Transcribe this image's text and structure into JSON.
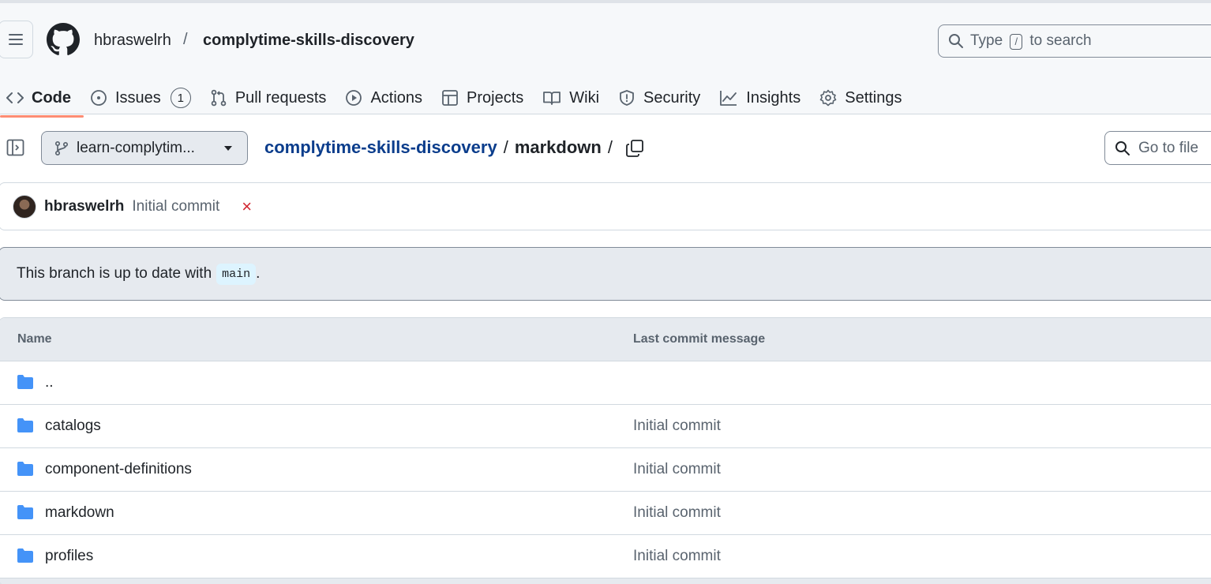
{
  "header": {
    "owner": "hbraswelrh",
    "separator": "/",
    "repo": "complytime-skills-discovery",
    "search": {
      "prefix": "Type",
      "key": "/",
      "suffix": "to search"
    }
  },
  "tabs": [
    {
      "label": "Code",
      "icon": "code-icon",
      "active": true
    },
    {
      "label": "Issues",
      "icon": "issue-opened-icon",
      "counter": "1"
    },
    {
      "label": "Pull requests",
      "icon": "git-pull-request-icon"
    },
    {
      "label": "Actions",
      "icon": "play-icon"
    },
    {
      "label": "Projects",
      "icon": "table-icon"
    },
    {
      "label": "Wiki",
      "icon": "book-icon"
    },
    {
      "label": "Security",
      "icon": "shield-icon"
    },
    {
      "label": "Insights",
      "icon": "graph-icon"
    },
    {
      "label": "Settings",
      "icon": "gear-icon"
    }
  ],
  "branch": {
    "name": "learn-complytim..."
  },
  "breadcrumb": {
    "repo": "complytime-skills-discovery",
    "sep": "/",
    "current": "markdown",
    "trailing": "/"
  },
  "goto_file": {
    "label": "Go to file"
  },
  "latest_commit": {
    "author": "hbraswelrh",
    "message": "Initial commit",
    "status": "×"
  },
  "branch_status": {
    "text": "This branch is up to date with",
    "branch": "main",
    "end": "."
  },
  "table": {
    "headers": {
      "name": "Name",
      "message": "Last commit message"
    },
    "rows": [
      {
        "name": "..",
        "message": ""
      },
      {
        "name": "catalogs",
        "message": "Initial commit"
      },
      {
        "name": "component-definitions",
        "message": "Initial commit"
      },
      {
        "name": "markdown",
        "message": "Initial commit"
      },
      {
        "name": "profiles",
        "message": "Initial commit"
      }
    ]
  },
  "colors": {
    "link": "#0b3d8c",
    "folder": "#4493f8",
    "tab_underline": "#fd8c73",
    "fail": "#d1242f"
  }
}
